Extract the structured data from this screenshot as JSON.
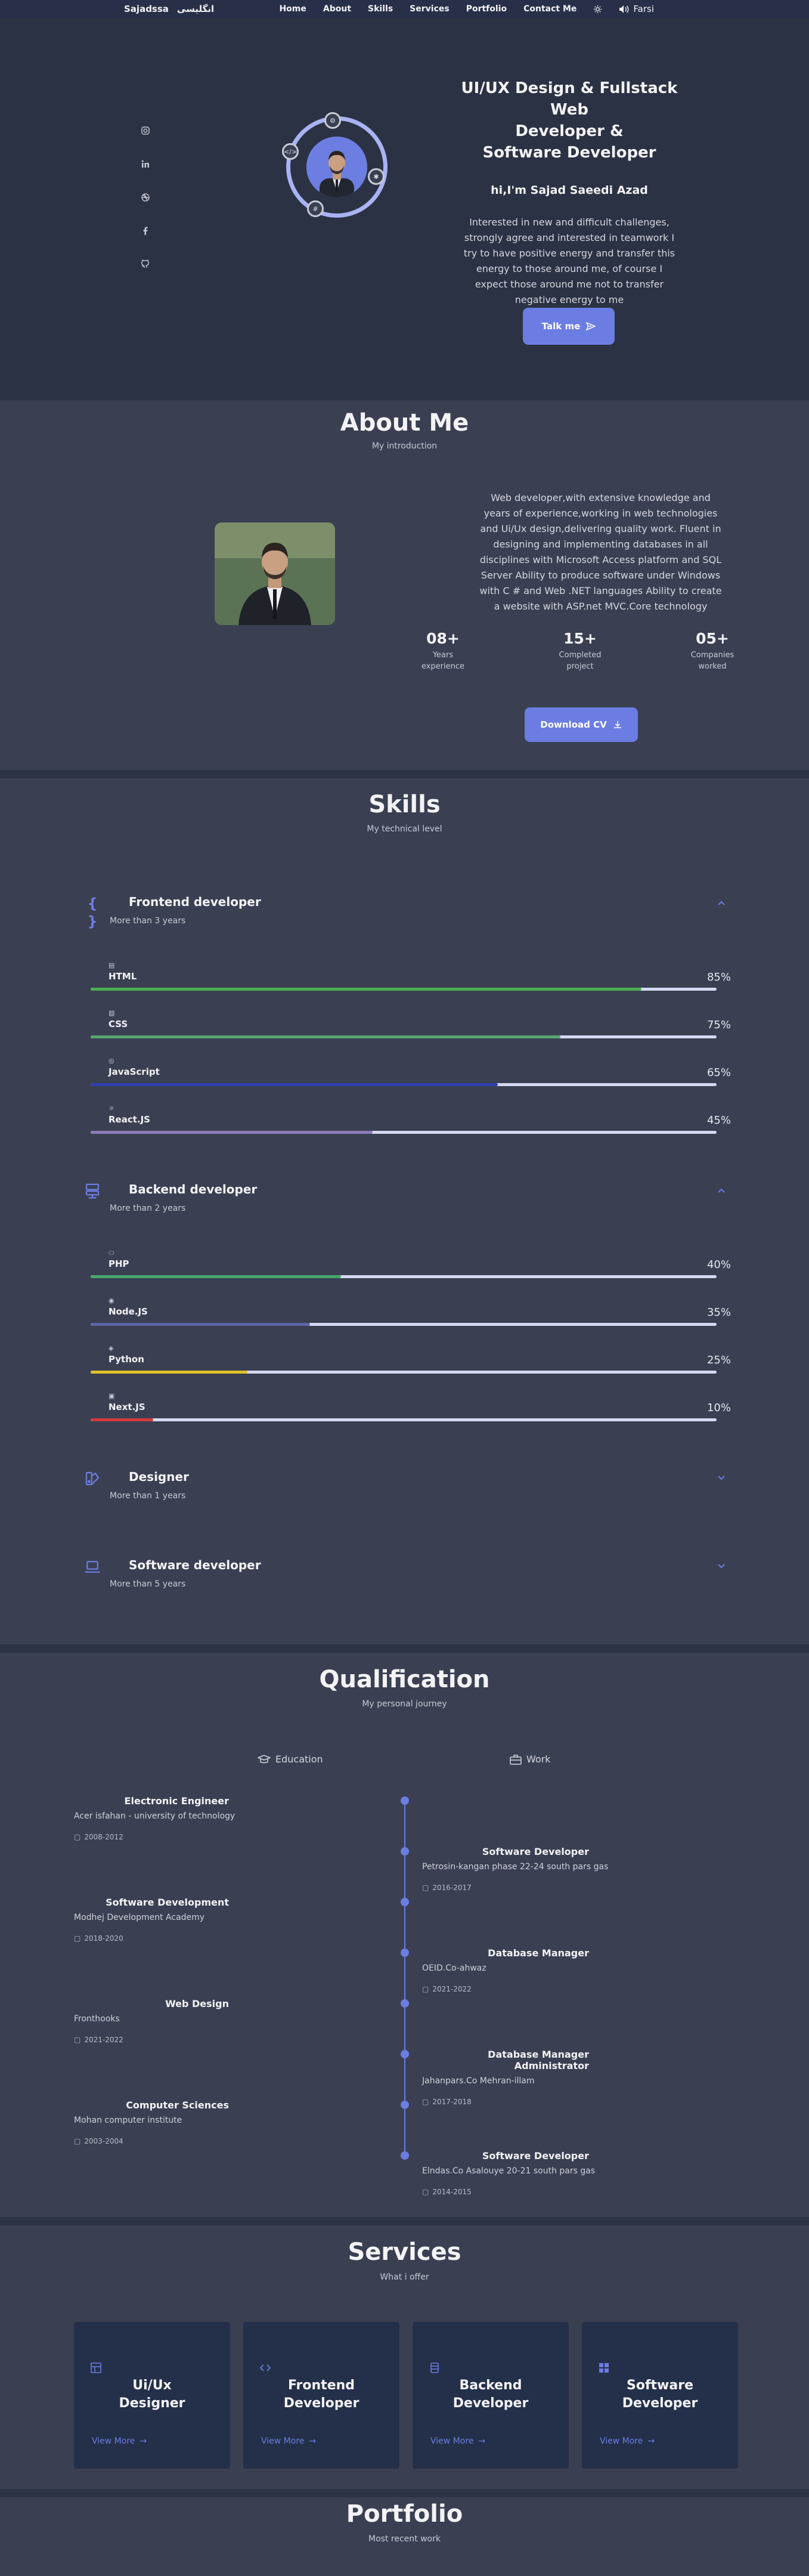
{
  "nav": {
    "brand": "Sajadssa",
    "brand_alt": "انگلیسی",
    "links": [
      "Home",
      "About",
      "Skills",
      "Services",
      "Portfolio",
      "Contact Me"
    ],
    "language_label": "Farsi"
  },
  "hero": {
    "title_line1": "UI/UX Design & Fullstack Web",
    "title_line2": "Developer &",
    "title_line3": "Software Developer",
    "subtitle": "hi,I'm Sajad Saeedi Azad",
    "description": "Interested in new and difficult challenges, strongly agree and interested in teamwork I try to have positive energy and transfer this energy to those around me, of course I expect those around me not to transfer negative energy to me",
    "button": "Talk me"
  },
  "about": {
    "title": "About Me",
    "subtitle": "My introduction",
    "description": "Web developer,with extensive knowledge and years of experience,working in web technologies and Ui/Ux design,delivering quality work. Fluent in designing and implementing databases in all disciplines with Microsoft Access platform and SQL Server Ability to produce software under Windows with C # and Web .NET languages Ability to create a website with ASP.net MVC.Core technology",
    "stats": [
      {
        "num": "08+",
        "label1": "Years",
        "label2": "experience"
      },
      {
        "num": "15+",
        "label1": "Completed",
        "label2": "project"
      },
      {
        "num": "05+",
        "label1": "Companies",
        "label2": "worked"
      }
    ],
    "button": "Download CV"
  },
  "skills": {
    "title": "Skills",
    "subtitle": "My technical level",
    "frontend": {
      "title": "Frontend developer",
      "sub": "More than 3 years",
      "items": [
        {
          "name": "HTML",
          "pct": "85%",
          "value": 0.88,
          "color": "#4caf50"
        },
        {
          "name": "CSS",
          "pct": "75%",
          "value": 0.75,
          "color": "#5aa46e"
        },
        {
          "name": "JavaScript",
          "pct": "65%",
          "value": 0.65,
          "color": "#2f3fb0"
        },
        {
          "name": "React.JS",
          "pct": "45%",
          "value": 0.45,
          "color": "#8a7db8"
        }
      ]
    },
    "backend": {
      "title": "Backend developer",
      "sub": "More than 2 years",
      "items": [
        {
          "name": "PHP",
          "pct": "40%",
          "value": 0.4,
          "color": "#48a86c"
        },
        {
          "name": "Node.JS",
          "pct": "35%",
          "value": 0.35,
          "color": "#5d67a8"
        },
        {
          "name": "Python",
          "pct": "25%",
          "value": 0.25,
          "color": "#e2c12a"
        },
        {
          "name": "Next.JS",
          "pct": "10%",
          "value": 0.1,
          "color": "#d23a3a"
        }
      ]
    },
    "designer": {
      "title": "Designer",
      "sub": "More than 1 years"
    },
    "software": {
      "title": "Software developer",
      "sub": "More than 5 years"
    }
  },
  "qualification": {
    "title": "Qualification",
    "subtitle": "My personal journey",
    "tab_education": "Education",
    "tab_work": "Work",
    "items": [
      {
        "side": "left",
        "title": "Electronic Engineer",
        "org": "Acer isfahan - university of technology",
        "date": "2008-2012"
      },
      {
        "side": "right",
        "title": "Software Developer",
        "org": "Petrosin-kangan phase 22-24 south pars gas",
        "date": "2016-2017"
      },
      {
        "side": "left",
        "title": "Software Development",
        "org": "Modhej Development Academy",
        "date": "2018-2020"
      },
      {
        "side": "right",
        "title": "Database Manager",
        "org": "OEID.Co-ahwaz",
        "date": "2021-2022"
      },
      {
        "side": "left",
        "title": "Web Design",
        "org": "Fronthooks",
        "date": "2021-2022"
      },
      {
        "side": "right",
        "title": "Database Manager Administrator",
        "org": "Jahanpars.Co Mehran-illam",
        "date": "2017-2018"
      },
      {
        "side": "left",
        "title": "Computer Sciences",
        "org": "Mohan computer institute",
        "date": "2003-2004"
      },
      {
        "side": "right",
        "title": "Software Developer",
        "org": "Elndas.Co Asalouye 20-21 south pars gas",
        "date": "2014-2015"
      }
    ]
  },
  "services": {
    "title": "Services",
    "subtitle": "What i offer",
    "cards": [
      {
        "line1": "Ui/Ux",
        "line2": "Designer",
        "more": "View More"
      },
      {
        "line1": "Frontend",
        "line2": "Developer",
        "more": "View More"
      },
      {
        "line1": "Backend",
        "line2": "Developer",
        "more": "View More"
      },
      {
        "line1": "Software",
        "line2": "Developer",
        "more": "View More"
      }
    ]
  },
  "portfolio": {
    "title": "Portfolio",
    "subtitle": "Most recent work"
  },
  "colors": {
    "accent": "#6b7de2",
    "page_bg": "#2c3344",
    "section_bg": "#3a4052",
    "card_bg": "#24304a"
  }
}
